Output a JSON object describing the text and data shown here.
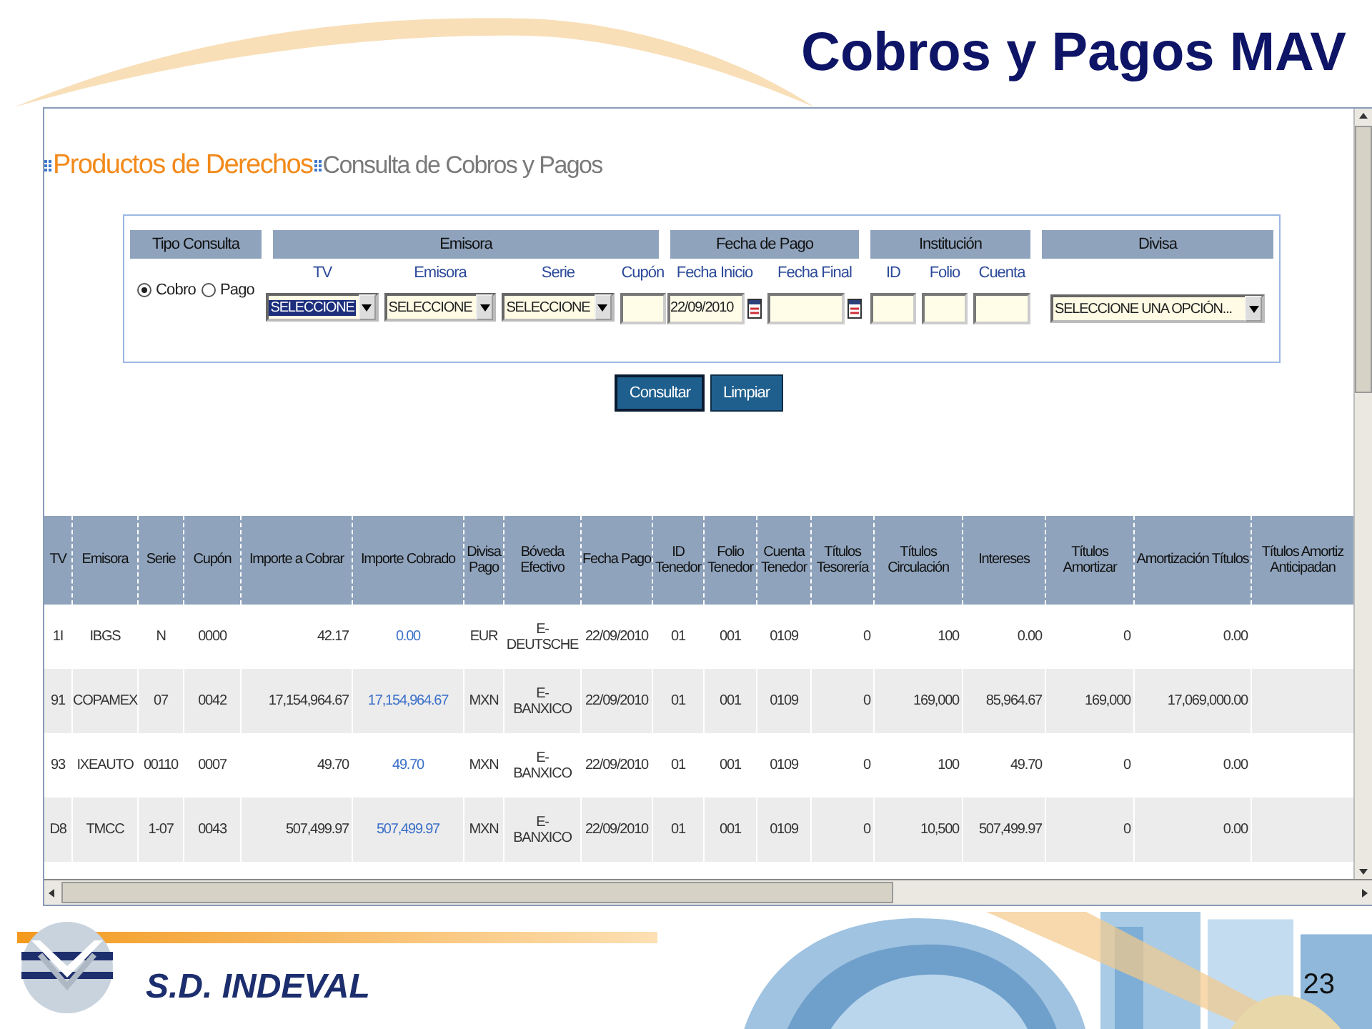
{
  "slide": {
    "title": "Cobros y Pagos MAV",
    "brand": "S.D. INDEVAL",
    "page_number": "23"
  },
  "breadcrumb": {
    "section": "Productos de Derechos",
    "page": "Consulta de Cobros y Pagos"
  },
  "filter_groups": [
    {
      "title": "Tipo Consulta",
      "kind": "radios",
      "options": [
        {
          "label": "Cobro",
          "selected": true
        },
        {
          "label": "Pago",
          "selected": false
        }
      ]
    },
    {
      "title": "Emisora",
      "kind": "fields",
      "fields": [
        {
          "label": "TV",
          "kind": "select",
          "value": "SELECCIONE",
          "focused": true
        },
        {
          "label": "Emisora",
          "kind": "select",
          "value": "SELECCIONE",
          "focused": false
        },
        {
          "label": "Serie",
          "kind": "select",
          "value": "SELECCIONE",
          "focused": false
        },
        {
          "label": "Cupón",
          "kind": "text"
        }
      ]
    },
    {
      "title": "Fecha de Pago",
      "kind": "fields",
      "fields": [
        {
          "label": "Fecha Inicio",
          "kind": "date",
          "value": "22/09/2010"
        },
        {
          "label": "Fecha Final",
          "kind": "date"
        }
      ]
    },
    {
      "title": "Institución",
      "kind": "fields",
      "fields": [
        {
          "label": "ID",
          "kind": "text"
        },
        {
          "label": "Folio",
          "kind": "text"
        },
        {
          "label": "Cuenta",
          "kind": "text"
        }
      ]
    },
    {
      "title": "Divisa",
      "kind": "fields",
      "fields": [
        {
          "kind": "select",
          "value": "SELECCIONE UNA OPCIÓN...",
          "focused": false
        }
      ]
    }
  ],
  "buttons": [
    "Consultar",
    "Limpiar"
  ],
  "table": {
    "columns": [
      {
        "label": "TV",
        "kind": "text"
      },
      {
        "label": "Emisora",
        "kind": "text"
      },
      {
        "label": "Serie",
        "kind": "text"
      },
      {
        "label": "Cupón",
        "kind": "text"
      },
      {
        "label": "Importe a Cobrar",
        "kind": "number"
      },
      {
        "label": "Importe Cobrado",
        "kind": "link"
      },
      {
        "label": "Divisa Pago",
        "kind": "text"
      },
      {
        "label": "Bóveda Efectivo",
        "kind": "text"
      },
      {
        "label": "Fecha Pago",
        "kind": "text"
      },
      {
        "label": "ID Tenedor",
        "kind": "text"
      },
      {
        "label": "Folio Tenedor",
        "kind": "text"
      },
      {
        "label": "Cuenta Tenedor",
        "kind": "text"
      },
      {
        "label": "Títulos Tesorería",
        "kind": "number"
      },
      {
        "label": "Títulos Circulación",
        "kind": "number"
      },
      {
        "label": "Intereses",
        "kind": "number"
      },
      {
        "label": "Títulos Amortizar",
        "kind": "number"
      },
      {
        "label": "Amortización Títulos",
        "kind": "number"
      },
      {
        "label": "Títulos Amortiz Anticipadan"
      }
    ],
    "rows": [
      [
        "1I",
        "IBGS",
        "N",
        "0000",
        "42.17",
        "0.00",
        "EUR",
        "E-DEUTSCHE",
        "22/09/2010",
        "01",
        "001",
        "0109",
        "0",
        "100",
        "0.00",
        "0",
        "0.00"
      ],
      [
        "91",
        "COPAMEX",
        "07",
        "0042",
        "17,154,964.67",
        "17,154,964.67",
        "MXN",
        "E-BANXICO",
        "22/09/2010",
        "01",
        "001",
        "0109",
        "0",
        "169,000",
        "85,964.67",
        "169,000",
        "17,069,000.00"
      ],
      [
        "93",
        "IXEAUTO",
        "00110",
        "0007",
        "49.70",
        "49.70",
        "MXN",
        "E-BANXICO",
        "22/09/2010",
        "01",
        "001",
        "0109",
        "0",
        "100",
        "49.70",
        "0",
        "0.00"
      ],
      [
        "D8",
        "TMCC",
        "1-07",
        "0043",
        "507,499.97",
        "507,499.97",
        "MXN",
        "E-BANXICO",
        "22/09/2010",
        "01",
        "001",
        "0109",
        "0",
        "10,500",
        "507,499.97",
        "0",
        "0.00"
      ]
    ]
  }
}
